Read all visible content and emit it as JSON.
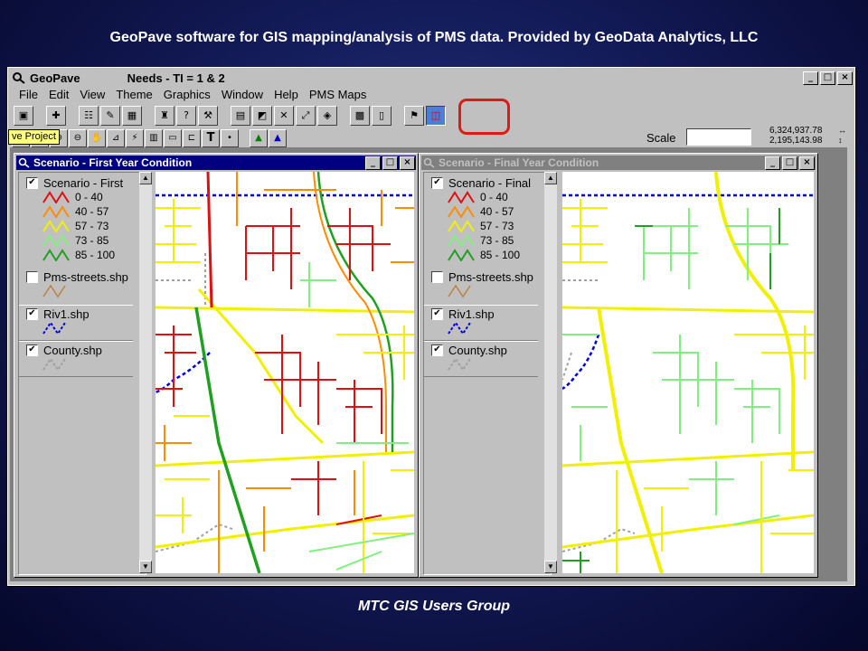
{
  "slide": {
    "header": "GeoPave software for GIS mapping/analysis of PMS data.  Provided by GeoData Analytics, LLC",
    "footer": "MTC GIS Users Group"
  },
  "app": {
    "name": "GeoPave",
    "window_title": "Needs - TI = 1 & 2",
    "window_controls": [
      "_",
      "□",
      "×"
    ],
    "menu": [
      "File",
      "Edit",
      "View",
      "Theme",
      "Graphics",
      "Window",
      "Help",
      "PMS Maps"
    ],
    "tooltip": "ve Project",
    "scale_label": "Scale",
    "scale_value": "",
    "coord_x": "6,324,937.78",
    "coord_y": "2,195,143.98",
    "highlight_color": "#e01818"
  },
  "toolbar1_icons": [
    "save-icon",
    "add-theme-icon",
    "theme-props-icon",
    "edit-legend-icon",
    "table-icon",
    "find-icon",
    "identify-icon",
    "hammer-icon",
    "chart-icon",
    "query-icon",
    "zoom-active-icon",
    "zoom-full-icon",
    "zoom-selected-icon",
    "pan-icon",
    "layout-icon",
    "info-icon",
    "pms-flag-icon",
    "pms-compare-icon"
  ],
  "toolbar2_icons": [
    "pointer-icon",
    "vertex-icon",
    "zoom-in-icon",
    "zoom-out-icon",
    "hand-icon",
    "measure-icon",
    "hotlink-icon",
    "area-icon",
    "select-icon",
    "label-icon",
    "text-icon",
    "point-icon",
    "triangle-a-icon",
    "triangle-b-icon"
  ],
  "windows": {
    "left": {
      "title": "Scenario - First Year Condition",
      "themes": [
        {
          "name": "Scenario - First",
          "checked": true,
          "classes": [
            {
              "label": "0 - 40",
              "color": "#e01010"
            },
            {
              "label": "40 - 57",
              "color": "#ff8c00"
            },
            {
              "label": "57 - 73",
              "color": "#f0f000"
            },
            {
              "label": "73 - 85",
              "color": "#80f080"
            },
            {
              "label": "85 - 100",
              "color": "#20a020"
            }
          ]
        },
        {
          "name": "Pms-streets.shp",
          "checked": false,
          "color": "#c08040"
        },
        {
          "name": "Riv1.shp",
          "checked": true,
          "color": "#0000e0"
        },
        {
          "name": "County.shp",
          "checked": true,
          "color": "#a0a0a0"
        }
      ]
    },
    "right": {
      "title": "Scenario - Final Year Condition",
      "themes": [
        {
          "name": "Scenario - Final",
          "checked": true,
          "classes": [
            {
              "label": "0 - 40",
              "color": "#e01010"
            },
            {
              "label": "40 - 57",
              "color": "#ff8c00"
            },
            {
              "label": "57 - 73",
              "color": "#f0f000"
            },
            {
              "label": "73 - 85",
              "color": "#80f080"
            },
            {
              "label": "85 - 100",
              "color": "#20a020"
            }
          ]
        },
        {
          "name": "Pms-streets.shp",
          "checked": false,
          "color": "#c08040"
        },
        {
          "name": "Riv1.shp",
          "checked": true,
          "color": "#0000e0"
        },
        {
          "name": "County.shp",
          "checked": true,
          "color": "#a0a0a0"
        }
      ]
    }
  }
}
